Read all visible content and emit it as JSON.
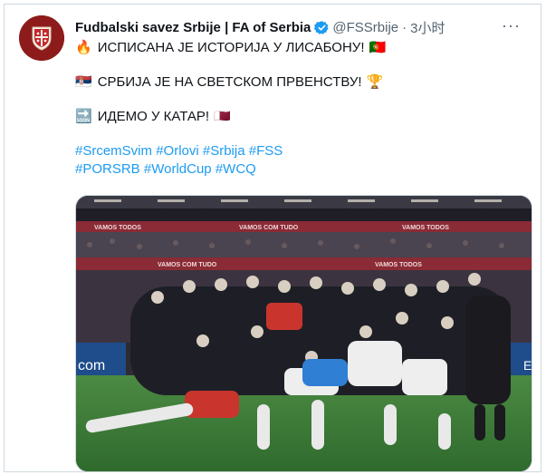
{
  "tweet": {
    "display_name": "Fudbalski savez Srbije | FA of Serbia",
    "handle": "@FSSrbije",
    "separator": "·",
    "time": "3小时",
    "more_label": "···",
    "lines": [
      {
        "emoji": "🔥",
        "text": "ИСПИСАНА ЈЕ ИСТОРИЈА У ЛИСАБОНУ!",
        "emoji_after": "🇵🇹"
      },
      {
        "emoji": "🇷🇸",
        "text": "СРБИЈА ЈЕ НА СВЕТСКОМ ПРВЕНСТВУ!",
        "emoji_after": "🏆"
      },
      {
        "emoji": "🔜",
        "text": "ИДЕМО У КАТАР!",
        "emoji_after": "🇶🇦"
      }
    ],
    "hashtags_line1": [
      "#SrcemSvim",
      "#Orlovi",
      "#Srbija",
      "#FSS"
    ],
    "hashtags_line2": [
      "#PORSRB",
      "#WorldCup",
      "#WCQ"
    ]
  },
  "media": {
    "banner_texts": [
      "VAMOS TODOS",
      "VAMOS COM TUDO",
      "VAMOS TODOS",
      "VAMOS COM TUDO",
      "VAMOS TODOS"
    ],
    "board_left": "com",
    "board_right": "E",
    "colors": {
      "pitch": "#3f7a3a",
      "stands": "#2a2a33",
      "banner": "#8a2b35",
      "accent": "#1d9bf0"
    }
  }
}
